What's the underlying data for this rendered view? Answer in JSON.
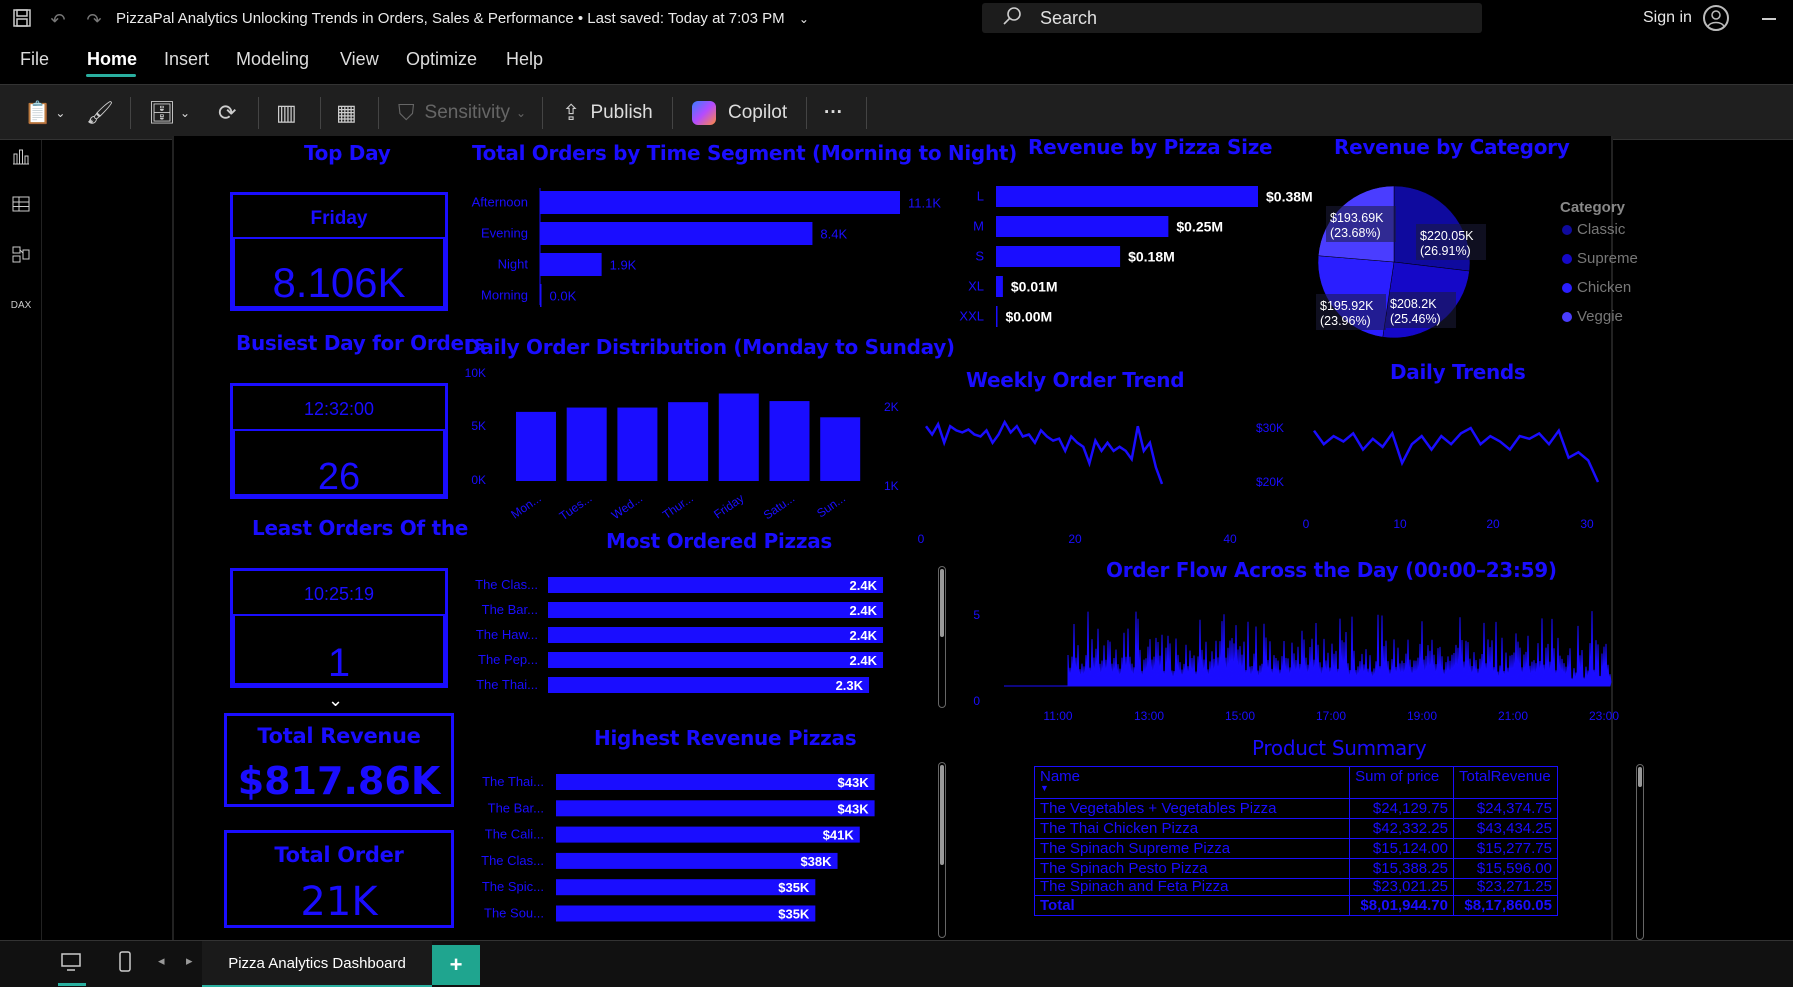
{
  "titlebar": {
    "document_title": "PizzaPal Analytics Unlocking Trends in Orders, Sales & Performance • Last saved: Today at 7:03 PM",
    "search_placeholder": "Search",
    "signin_label": "Sign in"
  },
  "menu": [
    "File",
    "Home",
    "Insert",
    "Modeling",
    "View",
    "Optimize",
    "Help"
  ],
  "ribbon": {
    "sensitivity_label": "Sensitivity",
    "publish_label": "Publish",
    "copilot_label": "Copilot",
    "more_label": "···"
  },
  "cards": {
    "top_day": {
      "title": "Top Day",
      "day": "Friday",
      "value": "8.106K"
    },
    "busiest": {
      "title": "Busiest Day for Orders",
      "time": "12:32:00",
      "value": "26"
    },
    "least": {
      "title": "Least Orders Of the",
      "time": "10:25:19",
      "value": "1"
    },
    "revenue": {
      "title": "Total Revenue",
      "value": "$817.86K"
    },
    "orders": {
      "title": "Total Order",
      "value": "21K"
    }
  },
  "visual_titles": {
    "time_segment": "Total Orders by Time Segment (Morning to Night)",
    "daily_dist": "Daily Order Distribution (Monday to Sunday)",
    "most_ordered": "Most Ordered Pizzas",
    "highest_revenue": "Highest Revenue Pizzas",
    "pizza_size": "Revenue by Pizza Size",
    "category": "Revenue by Category",
    "weekly": "Weekly Order Trend",
    "daily_trends": "Daily Trends",
    "order_flow": "Order Flow Across the Day (00:00–23:59)",
    "product_summary": "Product Summary"
  },
  "colors": {
    "accent": "#1a0dff",
    "teal": "#2ab0a0"
  },
  "chart_data": [
    {
      "id": "time_segment",
      "type": "bar",
      "orientation": "horizontal",
      "categories": [
        "Afternoon",
        "Evening",
        "Night",
        "Morning"
      ],
      "values": [
        11100,
        8400,
        1900,
        0
      ],
      "labels": [
        "11.1K",
        "8.4K",
        "1.9K",
        "0.0K"
      ]
    },
    {
      "id": "daily_dist",
      "type": "bar",
      "categories": [
        "Mon...",
        "Tues...",
        "Wed...",
        "Thur...",
        "Friday",
        "Satu...",
        "Sun..."
      ],
      "values": [
        6.4,
        6.8,
        6.8,
        7.3,
        8.1,
        7.4,
        5.9
      ],
      "y_ticks": [
        "10K",
        "5K",
        "0K"
      ],
      "y2_ticks": [
        "2K",
        "1K"
      ]
    },
    {
      "id": "most_ordered",
      "type": "bar",
      "orientation": "horizontal",
      "categories": [
        "The Clas...",
        "The Bar...",
        "The Haw...",
        "The Pep...",
        "The Thai..."
      ],
      "values": [
        2.4,
        2.4,
        2.4,
        2.4,
        2.3
      ],
      "labels": [
        "2.4K",
        "2.4K",
        "2.4K",
        "2.4K",
        "2.3K"
      ]
    },
    {
      "id": "highest_revenue",
      "type": "bar",
      "orientation": "horizontal",
      "categories": [
        "The Thai...",
        "The Bar...",
        "The Cali...",
        "The Clas...",
        "The Spic...",
        "The Sou..."
      ],
      "values": [
        43,
        43,
        41,
        38,
        35,
        35
      ],
      "labels": [
        "$43K",
        "$43K",
        "$41K",
        "$38K",
        "$35K",
        "$35K"
      ]
    },
    {
      "id": "pizza_size",
      "type": "bar",
      "orientation": "horizontal",
      "categories": [
        "L",
        "M",
        "S",
        "XL",
        "XXL"
      ],
      "values": [
        0.38,
        0.25,
        0.18,
        0.01,
        0.0
      ],
      "labels": [
        "$0.38M",
        "$0.25M",
        "$0.18M",
        "$0.01M",
        "$0.00M"
      ]
    },
    {
      "id": "category",
      "type": "pie",
      "legend_title": "Category",
      "slices": [
        {
          "name": "Classic",
          "value": 220.05,
          "label": "$220.05K",
          "pct": "(26.91%)",
          "color": "#0f0a9e"
        },
        {
          "name": "Supreme",
          "value": 208.2,
          "label": "$208.2K",
          "pct": "(25.46%)",
          "color": "#1508c8"
        },
        {
          "name": "Chicken",
          "value": 195.92,
          "label": "$195.92K",
          "pct": "(23.96%)",
          "color": "#2a1eff"
        },
        {
          "name": "Veggie",
          "value": 193.69,
          "label": "$193.69K",
          "pct": "(23.68%)",
          "color": "#4a3dff"
        }
      ]
    },
    {
      "id": "weekly",
      "type": "line",
      "x_ticks": [
        "0",
        "20",
        "40"
      ],
      "values": [
        420,
        400,
        425,
        380,
        420,
        410,
        405,
        412,
        400,
        395,
        410,
        380,
        400,
        430,
        405,
        420,
        395,
        400,
        380,
        410,
        395,
        385,
        390,
        360,
        395,
        380,
        370,
        330,
        385,
        360,
        380,
        360,
        370,
        360,
        340,
        420,
        360,
        380,
        320,
        280
      ]
    },
    {
      "id": "daily_trends",
      "type": "line",
      "y_ticks": [
        "$30K",
        "$20K"
      ],
      "x_ticks": [
        "0",
        "10",
        "20",
        "30"
      ],
      "values": [
        29.5,
        27,
        28.5,
        27.5,
        29,
        26,
        28,
        26.5,
        29,
        23.5,
        27,
        28.5,
        26,
        28.5,
        27,
        29,
        30,
        27,
        28.5,
        27.5,
        26,
        28.5,
        28,
        29,
        27,
        29.5,
        24.5,
        25.5,
        24,
        20
      ]
    },
    {
      "id": "order_flow",
      "type": "area",
      "y_ticks": [
        "5",
        "0"
      ],
      "x_ticks": [
        "11:00",
        "13:00",
        "15:00",
        "17:00",
        "19:00",
        "21:00",
        "23:00"
      ]
    }
  ],
  "product_summary": {
    "columns": [
      "Name",
      "Sum of price",
      "TotalRevenue"
    ],
    "rows": [
      [
        "The Vegetables + Vegetables Pizza",
        "$24,129.75",
        "$24,374.75"
      ],
      [
        "The Thai Chicken Pizza",
        "$42,332.25",
        "$43,434.25"
      ],
      [
        "The Spinach Supreme Pizza",
        "$15,124.00",
        "$15,277.75"
      ],
      [
        "The Spinach Pesto Pizza",
        "$15,388.25",
        "$15,596.00"
      ],
      [
        "The Spinach and Feta Pizza",
        "$23,021.25",
        "$23,271.25"
      ]
    ],
    "total": [
      "Total",
      "$8,01,944.70",
      "$8,17,860.05"
    ]
  },
  "bottombar": {
    "page_tab": "Pizza Analytics Dashboard",
    "add_label": "+"
  }
}
